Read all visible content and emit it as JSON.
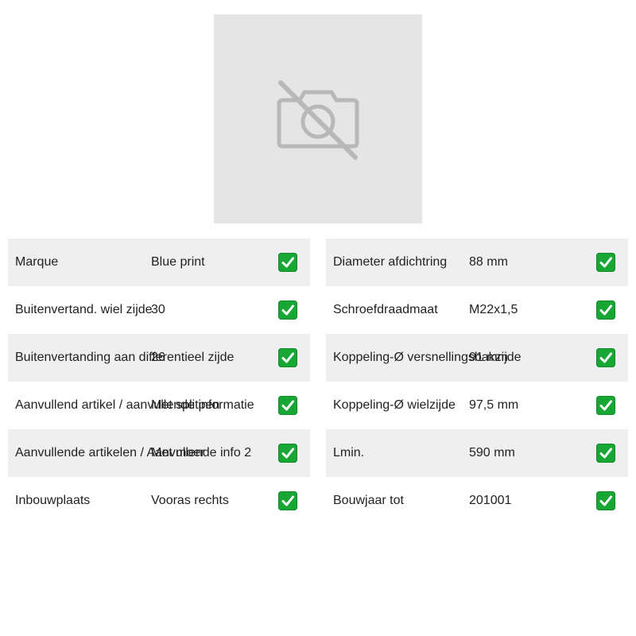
{
  "image": {
    "icon": "camera-off-icon",
    "background": "#e5e5e5"
  },
  "specs_left": [
    {
      "label": "Marque",
      "value": "Blue print",
      "icon": "check-icon"
    },
    {
      "label": "Buitenvertand. wiel zijde",
      "value": "30",
      "icon": "check-icon"
    },
    {
      "label": "Buitenvertanding aan differentieel zijde",
      "value": "26",
      "icon": "check-icon"
    },
    {
      "label": "Aanvullend artikel / aanvullende informatie",
      "value": "Met splitpen",
      "icon": "check-icon"
    },
    {
      "label": "Aanvullende artikelen / Aanvullende info 2",
      "value": "Met moer",
      "icon": "check-icon"
    },
    {
      "label": "Inbouwplaats",
      "value": "Vooras rechts",
      "icon": "check-icon"
    }
  ],
  "specs_right": [
    {
      "label": "Diameter afdichtring",
      "value": "88 mm",
      "icon": "check-icon"
    },
    {
      "label": "Schroefdraadmaat",
      "value": "M22x1,5",
      "icon": "check-icon"
    },
    {
      "label": "Koppeling-Ø versnellingsbakzijde",
      "value": "91 mm",
      "icon": "check-icon"
    },
    {
      "label": "Koppeling-Ø wielzijde",
      "value": "97,5 mm",
      "icon": "check-icon"
    },
    {
      "label": "Lmin.",
      "value": "590 mm",
      "icon": "check-icon"
    },
    {
      "label": "Bouwjaar tot",
      "value": "201001",
      "icon": "check-icon"
    }
  ],
  "colors": {
    "row_shade": "#efefef",
    "check_green": "#18a735"
  }
}
